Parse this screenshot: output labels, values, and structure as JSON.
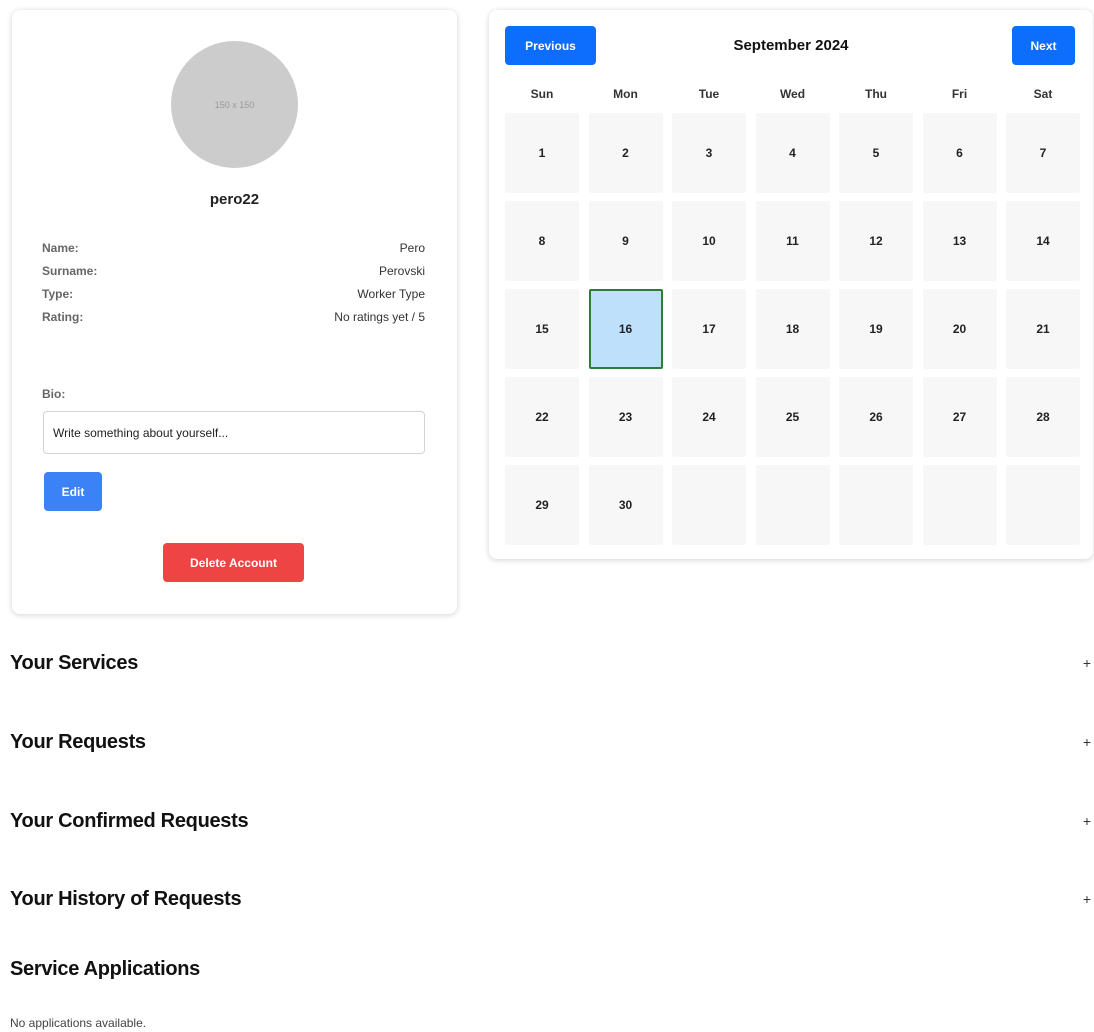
{
  "profile": {
    "avatar_placeholder": "150 x 150",
    "username": "pero22",
    "fields": [
      {
        "label": "Name:",
        "value": "Pero"
      },
      {
        "label": "Surname:",
        "value": "Perovski"
      },
      {
        "label": "Type:",
        "value": "Worker Type"
      },
      {
        "label": "Rating:",
        "value": "No ratings yet / 5"
      }
    ],
    "bio_label": "Bio:",
    "bio_placeholder": "Write something about yourself...",
    "edit_label": "Edit",
    "delete_label": "Delete Account"
  },
  "calendar": {
    "prev_label": "Previous",
    "next_label": "Next",
    "month_title": "September 2024",
    "weekdays": [
      "Sun",
      "Mon",
      "Tue",
      "Wed",
      "Thu",
      "Fri",
      "Sat"
    ],
    "days": [
      "1",
      "2",
      "3",
      "4",
      "5",
      "6",
      "7",
      "8",
      "9",
      "10",
      "11",
      "12",
      "13",
      "14",
      "15",
      "16",
      "17",
      "18",
      "19",
      "20",
      "21",
      "22",
      "23",
      "24",
      "25",
      "26",
      "27",
      "28",
      "29",
      "30"
    ],
    "selected_day": "16",
    "selected_color": "#bfe0fb",
    "selected_border_color": "#2e7d32"
  },
  "sections": [
    {
      "title": "Your Services",
      "toggle": "+"
    },
    {
      "title": "Your Requests",
      "toggle": "+"
    },
    {
      "title": "Your Confirmed Requests",
      "toggle": "+"
    },
    {
      "title": "Your History of Requests",
      "toggle": "+"
    }
  ],
  "applications": {
    "title": "Service Applications",
    "empty_text": "No applications available."
  },
  "colors": {
    "primary_button": "#0d6efd",
    "edit_button": "#3b82f6",
    "danger_button": "#ef4444"
  }
}
